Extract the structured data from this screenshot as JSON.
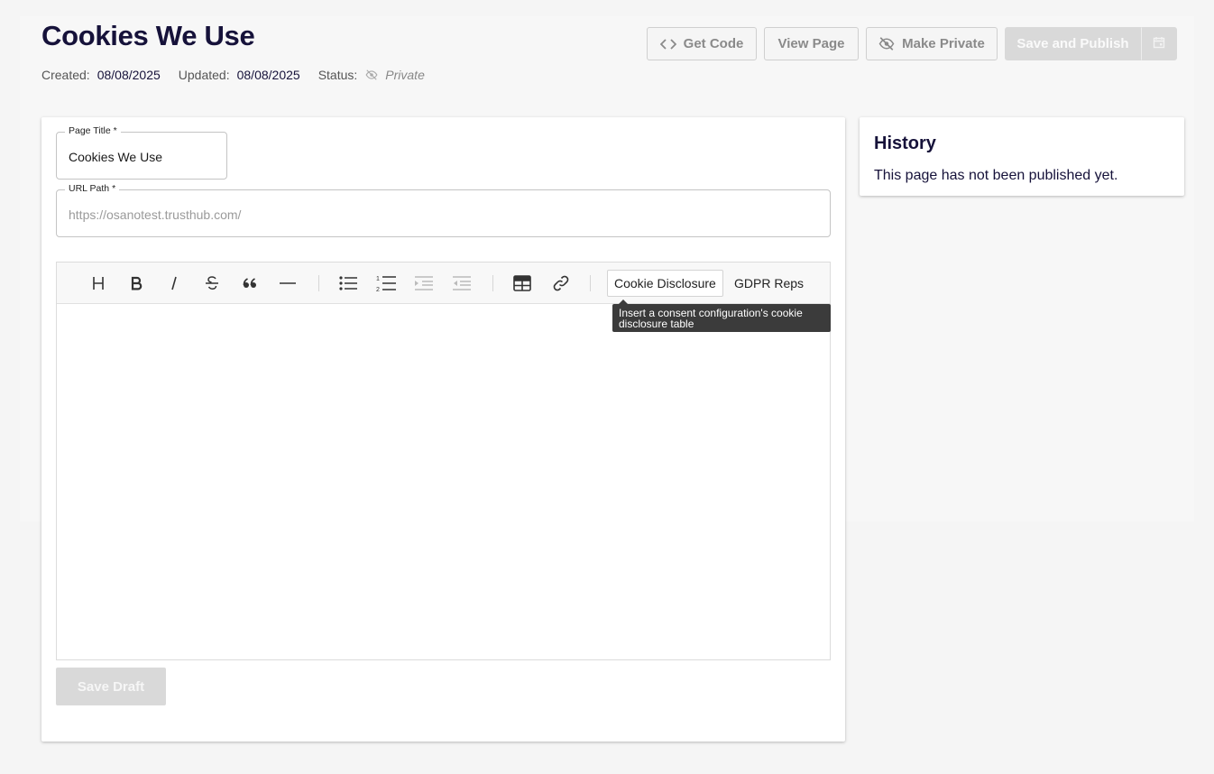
{
  "page": {
    "title": "Cookies We Use",
    "meta": {
      "created_label": "Created:",
      "created_value": "08/08/2025",
      "updated_label": "Updated:",
      "updated_value": "08/08/2025",
      "status_label": "Status:",
      "status_icon": "eye-off-icon",
      "status_value": "Private"
    }
  },
  "actions": {
    "get_code": {
      "label": "Get Code",
      "icon": "code-icon"
    },
    "view_page": {
      "label": "View Page"
    },
    "make_private": {
      "label": "Make Private",
      "icon": "eye-off-icon"
    },
    "save_publish": {
      "label": "Save and Publish",
      "disabled": true
    },
    "schedule": {
      "icon": "calendar-icon",
      "disabled": true
    }
  },
  "form": {
    "page_title": {
      "label": "Page Title",
      "required_mark": "*",
      "value": "Cookies We Use"
    },
    "url_path": {
      "label": "URL Path",
      "required_mark": "*",
      "placeholder": "https://osanotest.trusthub.com/"
    }
  },
  "editor": {
    "toolbar": {
      "icons": [
        "heading-icon",
        "bold-icon",
        "italic-icon",
        "strikethrough-icon",
        "blockquote-icon",
        "horizontal-rule-icon",
        "bullet-list-icon",
        "ordered-list-icon",
        "indent-icon",
        "outdent-icon",
        "table-icon",
        "link-icon"
      ],
      "cookie_disclosure_label": "Cookie Disclosure",
      "gdpr_reps_label": "GDPR Reps"
    },
    "tooltip": "Insert a consent configuration's cookie disclosure table",
    "content": ""
  },
  "save_draft": {
    "label": "Save Draft",
    "disabled": true
  },
  "history": {
    "title": "History",
    "message": "This page has not been published yet."
  },
  "colors": {
    "title_text": "#16123a",
    "disabled_button": "#d9d9d9",
    "tooltip_bg": "#3b3b3b",
    "page_bg": "#f5f5f5"
  }
}
